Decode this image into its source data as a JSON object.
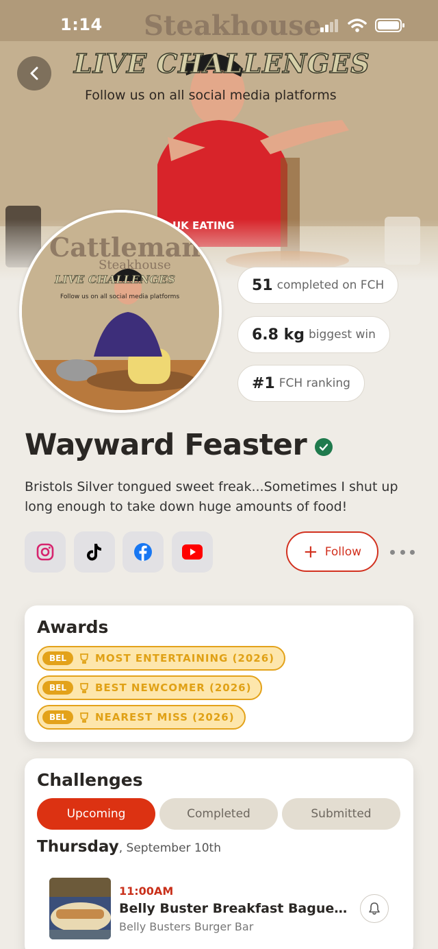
{
  "status_bar": {
    "time": "1:14"
  },
  "hero": {
    "poster_lines": [
      "Steakhouse",
      "LIVE CHALLENGES",
      "Follow us on all social media platforms"
    ],
    "shirt_text": "UK EATING"
  },
  "avatar": {
    "poster_lines": [
      "Cattleman's",
      "Steakhouse",
      "LIVE CHALLENGES",
      "Follow us on all social media platforms"
    ]
  },
  "stats": [
    {
      "value": "51",
      "label": "completed on FCH"
    },
    {
      "value": "6.8 kg",
      "label": "biggest win"
    },
    {
      "value": "#1",
      "label": "FCH ranking"
    }
  ],
  "profile": {
    "name": "Wayward Feaster",
    "bio": "Bristols Silver tongued sweet freak...Sometimes I shut up long enough to take down huge amounts of food!"
  },
  "social": [
    {
      "icon": "instagram-icon",
      "color": "#d6246e"
    },
    {
      "icon": "tiktok-icon",
      "color": "#000000"
    },
    {
      "icon": "facebook-icon",
      "color": "#1877f2"
    },
    {
      "icon": "youtube-icon",
      "color": "#ff0000"
    }
  ],
  "actions": {
    "follow_label": "Follow"
  },
  "awards": {
    "title": "Awards",
    "items": [
      {
        "tag": "BEL",
        "label": "MOST ENTERTAINING (2026)"
      },
      {
        "tag": "BEL",
        "label": "BEST NEWCOMER (2026)"
      },
      {
        "tag": "BEL",
        "label": "NEAREST MISS (2026)"
      }
    ]
  },
  "challenges": {
    "title": "Challenges",
    "tabs": [
      {
        "label": "Upcoming",
        "active": true
      },
      {
        "label": "Completed",
        "active": false
      },
      {
        "label": "Submitted",
        "active": false
      }
    ],
    "day": "Thursday",
    "date": ", September 10th",
    "events": [
      {
        "time": "11:00AM",
        "title": "Belly Buster Breakfast Baguette C...",
        "venue": "Belly Busters Burger Bar"
      }
    ]
  },
  "colors": {
    "accent": "#dc3212",
    "award_gold": "#e3a21a",
    "verified_green": "#1f7a4d",
    "background": "#efece6"
  }
}
